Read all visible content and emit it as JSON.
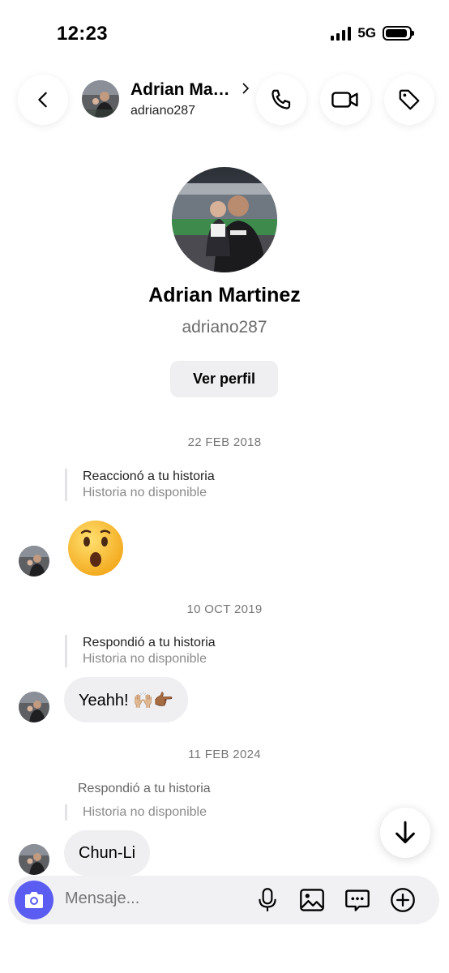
{
  "status_bar": {
    "time": "12:23",
    "network": "5G"
  },
  "header": {
    "name": "Adrian Ma…",
    "username": "adriano287",
    "back_icon": "chevron-left-icon",
    "call_icon": "phone-icon",
    "video_icon": "video-camera-icon",
    "tag_icon": "tag-icon"
  },
  "profile": {
    "name": "Adrian Martinez",
    "username": "adriano287",
    "view_profile_label": "Ver perfil"
  },
  "conversation": [
    {
      "date": "22 FEB 2018",
      "story_ref": {
        "action": "Reaccionó a tu historia",
        "status": "Historia no disponible"
      },
      "message": "😮"
    },
    {
      "date": "10 OCT 2019",
      "story_ref": {
        "action": "Respondió a tu historia",
        "status": "Historia no disponible"
      },
      "message": "Yeahh! 🙌🏼👉🏾"
    },
    {
      "date": "11 FEB 2024",
      "story_ref": {
        "action": "Respondió a tu historia",
        "status": "Historia no disponible"
      },
      "message": "Chun-Li"
    }
  ],
  "composer": {
    "placeholder": "Mensaje...",
    "icons": [
      "camera-icon",
      "microphone-icon",
      "gallery-icon",
      "sticker-icon",
      "plus-icon"
    ]
  },
  "colors": {
    "accent": "#5b5cf2",
    "bubble": "#efeff2"
  }
}
